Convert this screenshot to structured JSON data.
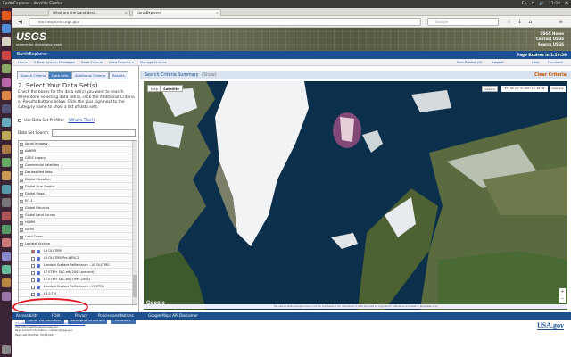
{
  "os_bar": {
    "title": "EarthExplorer - Mozilla Firefox",
    "tray": [
      "En",
      "⇅",
      "🔊",
      "11:24",
      "⚙"
    ]
  },
  "browser": {
    "tabs": [
      {
        "label": "What are the band desi...",
        "close": "×"
      },
      {
        "label": "EarthExplorer",
        "close": "×"
      }
    ],
    "url": "earthexplorer.usgs.gov",
    "search_placeholder": "Google"
  },
  "usgs": {
    "logo": "USGS",
    "tagline": "science for a changing world",
    "links": [
      "USGS Home",
      "Contact USGS",
      "Search USGS"
    ]
  },
  "app": {
    "title": "EarthExplorer",
    "session": "Page Expires in 1:59:59",
    "help": "Help",
    "feedback": "Feedback"
  },
  "menu": {
    "items": [
      "Home",
      "2 New System Messages",
      "Save Criteria",
      "Load Favorite ▾",
      "Manage Criteria"
    ],
    "user": "Bert Bastiot (0)",
    "logout": "Logout"
  },
  "left_panel": {
    "tabs": [
      "Search Criteria",
      "Data Sets",
      "Additional Criteria",
      "Results"
    ],
    "active_tab": 1,
    "title": "2. Select Your Data Set(s)",
    "description": "Check the boxes for the data set(s) you want to search. When done selecting data set(s), click the Additional Criteria or Results buttons below. Click the plus sign next to the category name to show a list of data sets.",
    "prefilter_label": "Use Data Set Prefilter",
    "prefilter_link": "(What's This?)",
    "search_label": "Data Set Search:",
    "datasets": [
      "Aerial Imagery",
      "AVHRR",
      "CEOS Legacy",
      "Commercial Satellites",
      "Declassified Data",
      "Digital Elevation",
      "Digital Line Graphs",
      "Digital Maps",
      "EO-1",
      "Global Fiducials",
      "Global Land Survey",
      "HCMM",
      "ISERV",
      "Land Cover",
      "Landsat Archive"
    ],
    "subsets": [
      "L8 OLI/TIRS",
      "L8 OLI/TIRS Pre-WRS-2",
      "Landsat Surface Reflectance - L8 OLI/TIRS",
      "L7 ETM+ SLC-off (2003-present)",
      "L7 ETM+ SLC-on (1999-2003)",
      "Landsat Surface Reflectance - L7 ETM+",
      "L4-5 TM"
    ],
    "buttons": [
      "Clear All Selected",
      "Additional Criteria »",
      "Results »"
    ]
  },
  "right_panel": {
    "header": "Search Criteria Summary",
    "header_note": "(Show)",
    "clear": "Clear Criteria",
    "map_types": [
      "Map",
      "Satellite"
    ],
    "coords": "87° 36' 07\" N, 000° 14' 46\" W",
    "options": "Options",
    "overlays": "Overlays",
    "google": "Google",
    "attribution": "Map Data ©2015 Google, INEGI Imagery ©2015 NASA, TerraMetrics   Terms of Use   Report a map error",
    "disclaimer": "The use-to-Date Google map is not for purchase or for download; it is to be used as a guide for reference and search purposes only."
  },
  "footer": {
    "links": [
      "Accessibility",
      "FOIA",
      "Privacy",
      "Policies and Notices",
      "Google Maps API Disclaimer"
    ],
    "info": [
      "U.S. Department of the Interior | U.S. Geological Survey",
      "URL: http://earthexplorer.usgs.gov",
      "Page Contact Information: custserv@usgs.gov",
      "Page Last Modified: 09/15/2015"
    ],
    "usagov": "USA.gov"
  },
  "colors": {
    "brand_blue": "#1b4f8e",
    "highlight_red": "#e31c23",
    "ocean": "#0c2f4c"
  }
}
